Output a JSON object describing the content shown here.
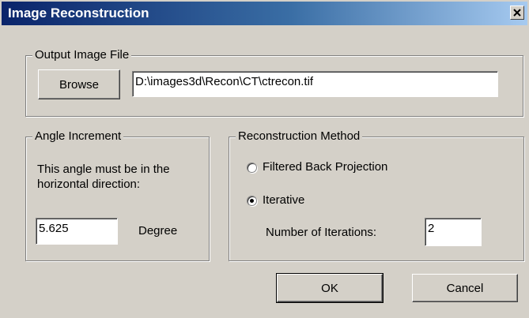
{
  "window": {
    "title": "Image Reconstruction",
    "close_glyph": "✕"
  },
  "output_file": {
    "group_label": "Output Image File",
    "browse_label": "Browse",
    "path_value": "D:\\images3d\\Recon\\CT\\ctrecon.tif"
  },
  "angle": {
    "group_label": "Angle Increment",
    "description_line1": "This angle must be in the",
    "description_line2": "horizontal direction:",
    "value": "5.625",
    "unit_label": "Degree"
  },
  "method": {
    "group_label": "Reconstruction Method",
    "options": [
      {
        "label": "Filtered Back Projection",
        "selected": false
      },
      {
        "label": "Iterative",
        "selected": true
      }
    ],
    "iterations_label": "Number of Iterations:",
    "iterations_value": "2"
  },
  "buttons": {
    "ok_label": "OK",
    "cancel_label": "Cancel"
  },
  "icons": {
    "close": "close-icon",
    "radio_selected": "radio-selected-icon",
    "radio_unselected": "radio-unselected-icon"
  }
}
